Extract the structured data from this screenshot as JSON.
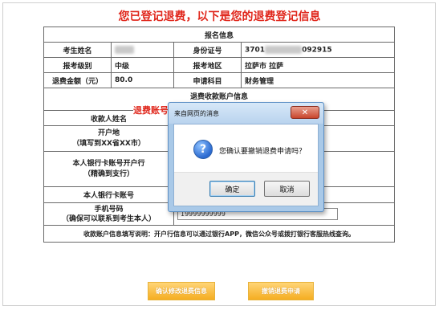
{
  "page": {
    "title": "您已登记退费，以下是您的退费登记信息",
    "red_note": "退费账号",
    "footer_note": "收款账户信息填写说明：开户行信息可以通过银行APP，微信公众号或拨打银行客服热线查询。"
  },
  "registration": {
    "section_title": "报名信息",
    "name_label": "考生姓名",
    "id_label": "身份证号",
    "id_prefix": "3701",
    "id_suffix": "092915",
    "level_label": "报考级别",
    "level_value": "中级",
    "region_label": "报考地区",
    "region_value": "拉萨市 拉萨",
    "amount_label": "退费金额（元）",
    "amount_value": "80.0",
    "subject_label": "申请科目",
    "subject_value": "财务管理"
  },
  "refund_account": {
    "section_title": "退费收款账户信息",
    "payee_label": "收款人姓名",
    "bank_place_label_1": "开户地",
    "bank_place_label_2": "（填写到XX省XX市）",
    "branch_label_1": "本人银行卡账号开户行",
    "branch_label_2": "（精确到支行）",
    "card_label": "本人银行卡账号",
    "phone_label_1": "手机号码",
    "phone_label_2": "（确保可以联系到考生本人）",
    "phone_value": "19999999999"
  },
  "buttons": {
    "confirm_modify": "确认修改退费信息",
    "cancel_refund": "撤销退费申请"
  },
  "dialog": {
    "title": "来自网页的消息",
    "close_symbol": "✕",
    "message": "您确认要撤销退费申请吗？",
    "ok_label": "确定",
    "cancel_label": "取消",
    "icon_symbol": "?"
  }
}
